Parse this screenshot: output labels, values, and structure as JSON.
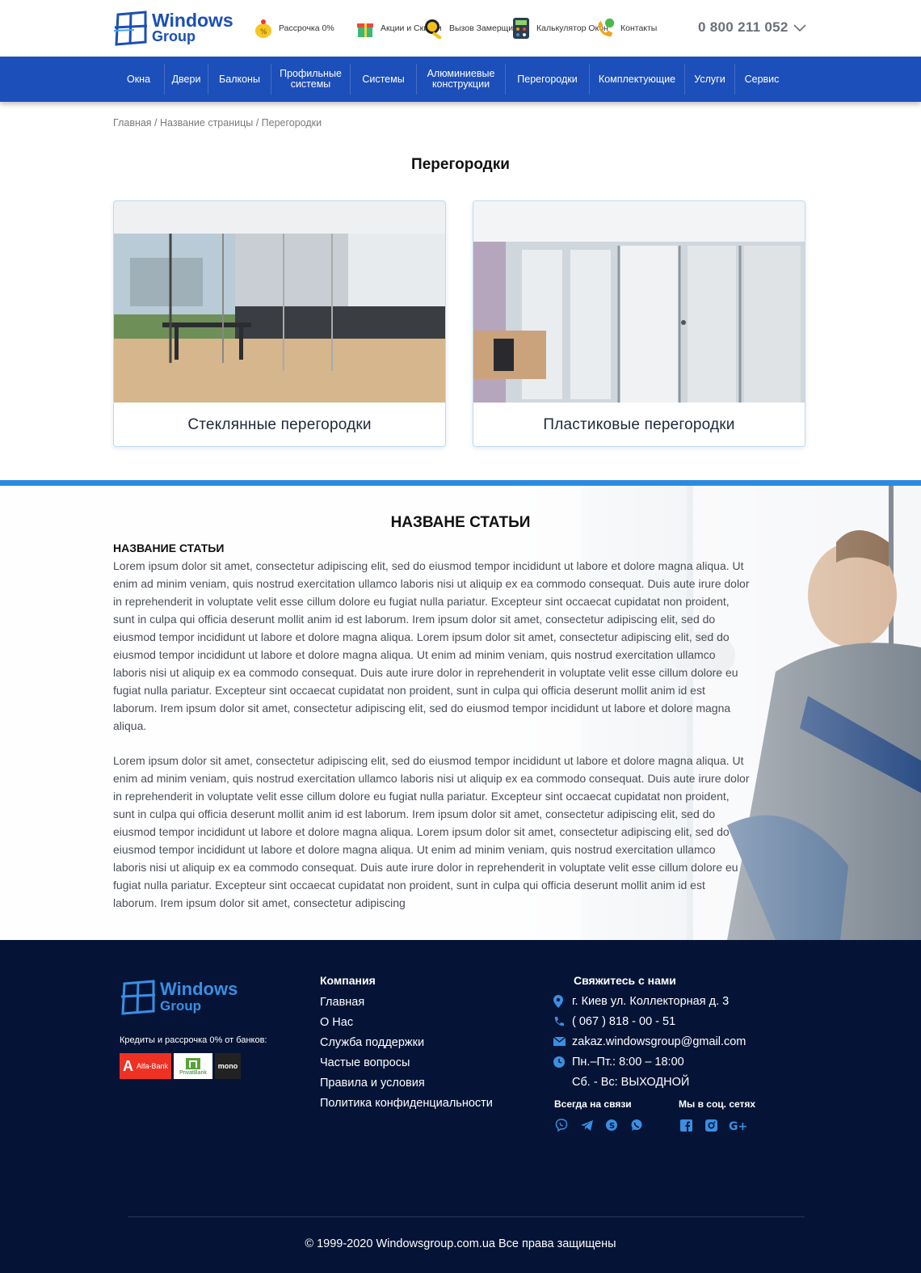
{
  "brand": {
    "name_line1": "Windows",
    "name_line2": "Group",
    "color": "#1b4fb6"
  },
  "header": {
    "items": [
      {
        "icon": "piggy-bank-icon",
        "label": "Рассрочка 0%"
      },
      {
        "icon": "gift-icon",
        "label": "Акции и Скидки"
      },
      {
        "icon": "tape-measure-icon",
        "label": "Вызов Замерщика"
      },
      {
        "icon": "calculator-icon",
        "label": "Калькулятор Окон"
      },
      {
        "icon": "phone-call-icon",
        "label": "Контакты"
      }
    ],
    "phone": "0 800 211 052"
  },
  "nav": {
    "items": [
      "Окна",
      "Двери",
      "Балконы",
      "Профильные системы",
      "Системы",
      "Алюминиевые конструкции",
      "Перегородки",
      "Комплектующие",
      "Услуги",
      "Сервис"
    ]
  },
  "breadcrumb": "Главная / Название страницы / Перегородки",
  "page_title": "Перегородки",
  "cards": [
    {
      "caption": "Стеклянные перегородки"
    },
    {
      "caption": "Пластиковые перегородки"
    }
  ],
  "article": {
    "title": "НАЗВАНЕ СТАТЬИ",
    "subtitle": "НАЗВАНИЕ СТАТЬИ",
    "paragraph1": "Lorem ipsum dolor sit amet, consectetur adipiscing elit, sed do eiusmod tempor incididunt ut labore et dolore magna aliqua. Ut enim ad minim veniam, quis nostrud exercitation ullamco laboris nisi ut aliquip ex ea commodo consequat. Duis aute irure dolor in reprehenderit in voluptate velit esse cillum dolore eu fugiat nulla pariatur. Excepteur sint occaecat cupidatat non proident, sunt in culpa qui officia deserunt mollit anim id est laborum. Irem ipsum dolor sit amet, consectetur adipiscing elit, sed do eiusmod tempor incididunt ut labore et dolore magna aliqua. Lorem ipsum dolor sit amet, consectetur adipiscing elit, sed do eiusmod tempor incididunt ut labore et dolore magna aliqua. Ut enim ad minim veniam, quis nostrud exercitation ullamco laboris nisi ut aliquip ex ea commodo consequat. Duis aute irure dolor in reprehenderit in voluptate velit esse cillum dolore eu fugiat nulla pariatur. Excepteur sint occaecat cupidatat non proident, sunt in culpa qui officia deserunt mollit anim id est laborum. Irem ipsum dolor sit amet, consectetur adipiscing elit, sed do eiusmod tempor incididunt ut labore et dolore magna aliqua.",
    "paragraph2": "Lorem ipsum dolor sit amet, consectetur adipiscing elit, sed do eiusmod tempor incididunt ut labore et dolore magna aliqua. Ut enim ad minim veniam, quis nostrud exercitation ullamco laboris nisi ut aliquip ex ea commodo consequat. Duis aute irure dolor in reprehenderit in voluptate velit esse cillum dolore eu fugiat nulla pariatur. Excepteur sint occaecat cupidatat non proident, sunt in culpa qui officia deserunt mollit anim id est laborum. Irem ipsum dolor sit amet, consectetur adipiscing elit, sed do eiusmod tempor incididunt ut labore et dolore magna aliqua. Lorem ipsum dolor sit amet, consectetur adipiscing elit, sed do eiusmod tempor incididunt ut labore et dolore magna aliqua. Ut enim ad minim veniam, quis nostrud exercitation ullamco laboris nisi ut aliquip ex ea commodo consequat. Duis aute irure dolor in reprehenderit in voluptate velit esse cillum dolore eu fugiat nulla pariatur. Excepteur sint occaecat cupidatat non proident, sunt in culpa qui officia deserunt mollit anim id est laborum. Irem ipsum dolor sit amet, consectetur adipiscing"
  },
  "footer": {
    "credit_text": "Кредиты и рассрочка  0% от банков:",
    "banks": [
      "Alfa-Bank",
      "PrivatBank",
      "mono"
    ],
    "company_heading": "Компания",
    "company_links": [
      "Главная",
      "О Нас",
      "Служба поддержки",
      "Частые вопросы",
      "Правила и условия",
      "Политика конфиденциальности"
    ],
    "contact_heading": "Свяжитесь с нами",
    "address": "г. Киев  ул. Коллекторная д. 3",
    "phone": "( 067 ) 818 - 00 - 51",
    "email": "zakaz.windowsgroup@gmail.com",
    "hours_weekdays": "Пн.–Пт.: 8:00 – 18:00",
    "hours_weekend": "Сб. - Вс: ВЫХОДНОЙ",
    "messengers_heading": "Всегда на связи",
    "messengers": [
      "viber-icon",
      "telegram-icon",
      "skype-icon",
      "whatsapp-icon"
    ],
    "social_heading": "Мы в соц. сетях",
    "social": [
      "facebook-icon",
      "instagram-icon",
      "google-plus-icon"
    ],
    "copyright": "© 1999-2020 Windowsgroup.com.ua Все права защищены",
    "accent_color": "#3a8fe2",
    "background": "#051436"
  }
}
